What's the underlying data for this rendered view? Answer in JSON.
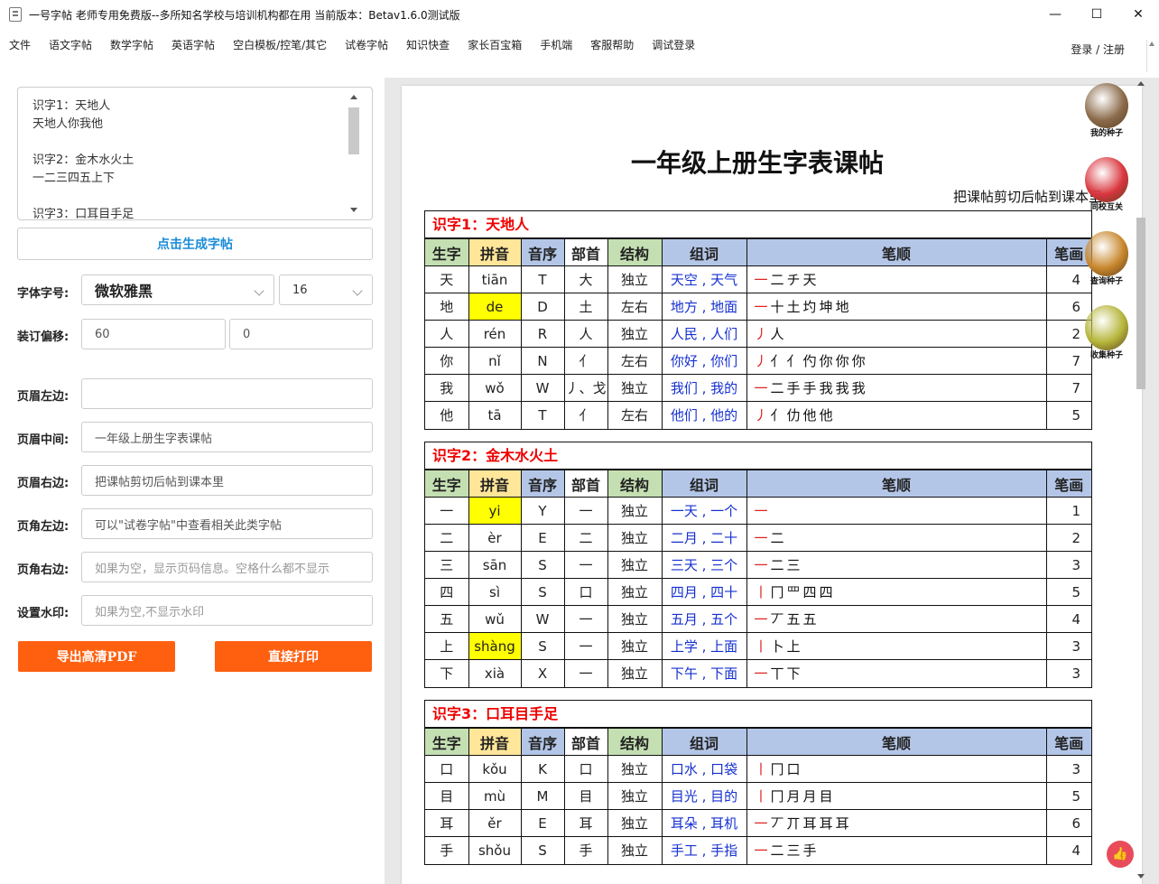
{
  "window": {
    "title": "一号字帖 老师专用免费版--多所知名学校与培训机构都在用 当前版本：Betav1.6.0测试版",
    "minimize": "—",
    "maximize": "☐",
    "close": "✕"
  },
  "menu": {
    "items": [
      "文件",
      "语文字帖",
      "数学字帖",
      "英语字帖",
      "空白模板/控笔/其它",
      "试卷字帖",
      "知识快查",
      "家长百宝箱",
      "手机端",
      "客服帮助",
      "调试登录"
    ],
    "login": "登录 / 注册"
  },
  "sidebar": {
    "identify_text": "识字1：天地人\n天地人你我他\n\n识字2：金木水火土\n一二三四五上下\n\n识字3：口耳目手足",
    "generate_label": "点击生成字帖",
    "font_label": "字体字号:",
    "font_value": "微软雅黑",
    "size_value": "16",
    "offset_label": "装订偏移:",
    "offset_x": "60",
    "offset_y": "0",
    "header_left_label": "页眉左边:",
    "header_left_value": "",
    "header_mid_label": "页眉中间:",
    "header_mid_value": "一年级上册生字表课帖",
    "header_right_label": "页眉右边:",
    "header_right_value": "把课帖剪切后帖到课本里",
    "footer_left_label": "页角左边:",
    "footer_left_value": "可以\"试卷字帖\"中查看相关此类字帖",
    "footer_right_label": "页角右边:",
    "footer_right_placeholder": "如果为空，显示页码信息。空格什么都不显示",
    "watermark_label": "设置水印:",
    "watermark_placeholder": "如果为空,不显示水印",
    "export_label": "导出高清PDF",
    "print_label": "直接打印"
  },
  "doc": {
    "title": "一年级上册生字表课帖",
    "header_right": "把课帖剪切后帖到课本里",
    "columns": [
      "生字",
      "拼音",
      "音序",
      "部首",
      "结构",
      "组词",
      "笔顺",
      "笔画"
    ],
    "groups": [
      {
        "title": "识字1：天地人",
        "rows": [
          {
            "char": "天",
            "py": "tiān",
            "yx": "T",
            "bs": "大",
            "jg": "独立",
            "words": "天空 , 天气",
            "strokes": [
              "一",
              "二",
              "チ",
              "天"
            ],
            "count": "4",
            "hl": false
          },
          {
            "char": "地",
            "py": "de",
            "yx": "D",
            "bs": "土",
            "jg": "左右",
            "words": "地方 , 地面",
            "strokes": [
              "一",
              "十",
              "土",
              "圴",
              "坤",
              "地"
            ],
            "count": "6",
            "hl": true
          },
          {
            "char": "人",
            "py": "rén",
            "yx": "R",
            "bs": "人",
            "jg": "独立",
            "words": "人民 , 人们",
            "strokes": [
              "丿",
              "人"
            ],
            "count": "2",
            "hl": false
          },
          {
            "char": "你",
            "py": "nǐ",
            "yx": "N",
            "bs": "亻",
            "jg": "左右",
            "words": "你好 , 你们",
            "strokes": [
              "丿",
              "亻",
              "亻",
              "仢",
              "你",
              "你",
              "你"
            ],
            "count": "7",
            "hl": false
          },
          {
            "char": "我",
            "py": "wǒ",
            "yx": "W",
            "bs": "丿、戈",
            "jg": "独立",
            "words": "我们 , 我的",
            "strokes": [
              "一",
              "二",
              "手",
              "手",
              "我",
              "我",
              "我"
            ],
            "count": "7",
            "hl": false
          },
          {
            "char": "他",
            "py": "tā",
            "yx": "T",
            "bs": "亻",
            "jg": "左右",
            "words": "他们 , 他的",
            "strokes": [
              "丿",
              "亻",
              "仂",
              "他",
              "他"
            ],
            "count": "5",
            "hl": false
          }
        ]
      },
      {
        "title": "识字2：金木水火土",
        "rows": [
          {
            "char": "一",
            "py": "yi",
            "yx": "Y",
            "bs": "一",
            "jg": "独立",
            "words": "一天 , 一个",
            "strokes": [
              "一"
            ],
            "count": "1",
            "hl": true
          },
          {
            "char": "二",
            "py": "èr",
            "yx": "E",
            "bs": "二",
            "jg": "独立",
            "words": "二月 , 二十",
            "strokes": [
              "一",
              "二"
            ],
            "count": "2",
            "hl": false
          },
          {
            "char": "三",
            "py": "sān",
            "yx": "S",
            "bs": "一",
            "jg": "独立",
            "words": "三天 , 三个",
            "strokes": [
              "一",
              "二",
              "三"
            ],
            "count": "3",
            "hl": false
          },
          {
            "char": "四",
            "py": "sì",
            "yx": "S",
            "bs": "口",
            "jg": "独立",
            "words": "四月 , 四十",
            "strokes": [
              "丨",
              "冂",
              "罒",
              "四",
              "四"
            ],
            "count": "5",
            "hl": false
          },
          {
            "char": "五",
            "py": "wǔ",
            "yx": "W",
            "bs": "一",
            "jg": "独立",
            "words": "五月 , 五个",
            "strokes": [
              "一",
              "丆",
              "五",
              "五"
            ],
            "count": "4",
            "hl": false
          },
          {
            "char": "上",
            "py": "shàng",
            "yx": "S",
            "bs": "一",
            "jg": "独立",
            "words": "上学 , 上面",
            "strokes": [
              "丨",
              "卜",
              "上"
            ],
            "count": "3",
            "hl": true
          },
          {
            "char": "下",
            "py": "xià",
            "yx": "X",
            "bs": "一",
            "jg": "独立",
            "words": "下午 , 下面",
            "strokes": [
              "一",
              "丅",
              "下"
            ],
            "count": "3",
            "hl": false
          }
        ]
      },
      {
        "title": "识字3：口耳目手足",
        "rows": [
          {
            "char": "口",
            "py": "kǒu",
            "yx": "K",
            "bs": "口",
            "jg": "独立",
            "words": "口水 , 口袋",
            "strokes": [
              "丨",
              "冂",
              "口"
            ],
            "count": "3",
            "hl": false
          },
          {
            "char": "目",
            "py": "mù",
            "yx": "M",
            "bs": "目",
            "jg": "独立",
            "words": "目光 , 目的",
            "strokes": [
              "丨",
              "冂",
              "月",
              "月",
              "目"
            ],
            "count": "5",
            "hl": false
          },
          {
            "char": "耳",
            "py": "ěr",
            "yx": "E",
            "bs": "耳",
            "jg": "独立",
            "words": "耳朵 , 耳机",
            "strokes": [
              "一",
              "丆",
              "丌",
              "耳",
              "耳",
              "耳"
            ],
            "count": "6",
            "hl": false
          },
          {
            "char": "手",
            "py": "shǒu",
            "yx": "S",
            "bs": "手",
            "jg": "独立",
            "words": "手工 , 手指",
            "strokes": [
              "一",
              "二",
              "三",
              "手"
            ],
            "count": "4",
            "hl": false
          }
        ]
      }
    ]
  },
  "seeds": [
    {
      "label": "我的种子",
      "color": "#8b6b4a"
    },
    {
      "label": "同校互关",
      "color": "#d9363e"
    },
    {
      "label": "查询种子",
      "color": "#c7862b"
    },
    {
      "label": "收集种子",
      "color": "#b5b53a"
    }
  ],
  "like_icon": "👍"
}
